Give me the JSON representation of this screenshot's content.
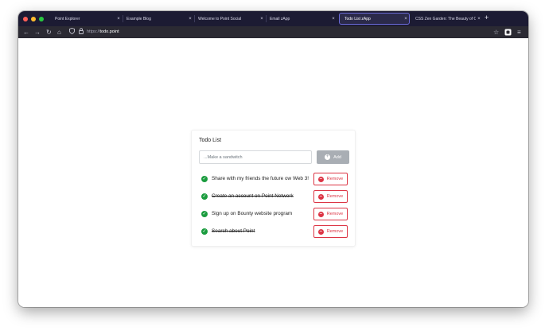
{
  "browser": {
    "tabs": [
      {
        "label": "Point Explorer",
        "active": false
      },
      {
        "label": "Example Blog",
        "active": false
      },
      {
        "label": "Welcome to Point Social",
        "active": false
      },
      {
        "label": "Email zApp",
        "active": false
      },
      {
        "label": "Todo List zApp",
        "active": true
      },
      {
        "label": "CSS Zen Garden: The Beauty of CSS",
        "active": false
      }
    ],
    "tab_close_glyph": "×",
    "new_tab_glyph": "+",
    "url_protocol": "https://",
    "url_host": "todo.point"
  },
  "todo": {
    "title": "Todo List",
    "input_placeholder": "...Make a sandwitch",
    "add_label": "Add",
    "items": [
      {
        "text": "Share with my friends the future ow Web 3!",
        "done": false,
        "remove_label": "Remove"
      },
      {
        "text": "Create an account on Point Network",
        "done": true,
        "remove_label": "Remove"
      },
      {
        "text": "Sign up on Bounty website program",
        "done": false,
        "remove_label": "Remove"
      },
      {
        "text": "Search about Point",
        "done": true,
        "remove_label": "Remove"
      }
    ]
  },
  "colors": {
    "accent_green": "#1a9c3e",
    "danger_red": "#dc3545",
    "add_button_gray": "#a9aeb4",
    "tabstrip_bg": "#1c1b33"
  }
}
